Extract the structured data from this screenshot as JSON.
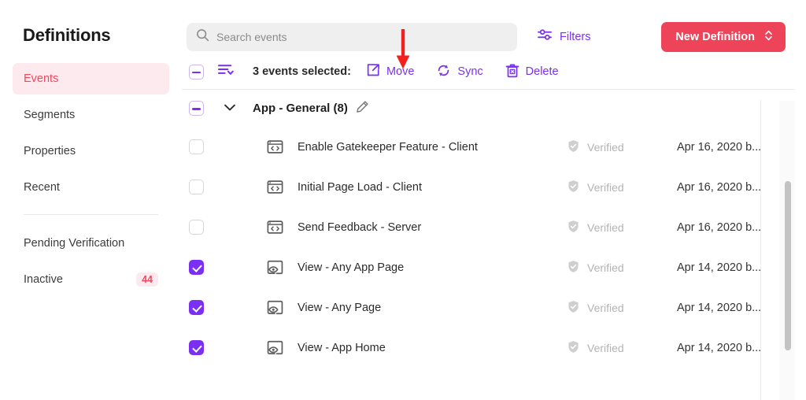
{
  "sidebar": {
    "title": "Definitions",
    "items": [
      {
        "label": "Events",
        "active": true
      },
      {
        "label": "Segments",
        "active": false
      },
      {
        "label": "Properties",
        "active": false
      },
      {
        "label": "Recent",
        "active": false
      }
    ],
    "secondary_items": [
      {
        "label": "Pending Verification",
        "badge": ""
      },
      {
        "label": "Inactive",
        "badge": "44"
      }
    ]
  },
  "search": {
    "placeholder": "Search events",
    "icon": "search-icon",
    "value": ""
  },
  "toolbar": {
    "filters_label": "Filters",
    "filters_icon": "sliders-icon",
    "new_definition_label": "New Definition",
    "new_definition_chevron": "chevron-up-down-icon"
  },
  "actionbar": {
    "select_all_state": "indeterminate",
    "sort_icon": "sort-descending-icon",
    "selection_text": "3 events selected:",
    "actions": [
      {
        "label": "Move",
        "icon": "move-box-arrow-icon"
      },
      {
        "label": "Sync",
        "icon": "sync-circular-arrows-icon"
      },
      {
        "label": "Delete",
        "icon": "trash-x-icon"
      }
    ]
  },
  "group": {
    "checkbox_state": "indeterminate",
    "chevron": "chevron-down-icon",
    "title": "App - General (8)",
    "edit_icon": "pencil-icon"
  },
  "rows": [
    {
      "checked": false,
      "icon": "code-window-icon",
      "name": "Enable Gatekeeper Feature - Client",
      "status": "Verified",
      "status_icon": "shield-check-icon",
      "date": "Apr 16, 2020 b..."
    },
    {
      "checked": false,
      "icon": "code-window-icon",
      "name": "Initial Page Load - Client",
      "status": "Verified",
      "status_icon": "shield-check-icon",
      "date": "Apr 16, 2020 b..."
    },
    {
      "checked": false,
      "icon": "code-window-icon",
      "name": "Send Feedback - Server",
      "status": "Verified",
      "status_icon": "shield-check-icon",
      "date": "Apr 16, 2020 b..."
    },
    {
      "checked": true,
      "icon": "page-view-icon",
      "name": "View - Any App Page",
      "status": "Verified",
      "status_icon": "shield-check-icon",
      "date": "Apr 14, 2020 b..."
    },
    {
      "checked": true,
      "icon": "page-view-icon",
      "name": "View - Any Page",
      "status": "Verified",
      "status_icon": "shield-check-icon",
      "date": "Apr 14, 2020 b..."
    },
    {
      "checked": true,
      "icon": "page-view-icon",
      "name": "View - App Home",
      "status": "Verified",
      "status_icon": "shield-check-icon",
      "date": "Apr 14, 2020 b..."
    }
  ],
  "annotation": {
    "type": "down-arrow",
    "color": "#f41f1f",
    "points_at": "Move"
  },
  "colors": {
    "accent_purple": "#7b2ff2",
    "accent_red": "#ee4459",
    "active_nav_text": "#f04a5e",
    "active_nav_bg": "#fdeaee",
    "muted_text": "#b3b3b3"
  }
}
